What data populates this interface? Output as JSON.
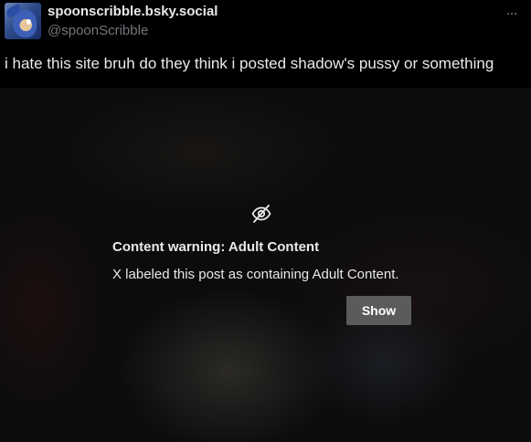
{
  "post": {
    "display_name": "spoonscribble.bsky.social",
    "handle": "@spoonScribble",
    "text": "i hate this site bruh do they think i posted shadow's pussy or something",
    "more_icon": "more-dots-icon",
    "avatar_icon": "avatar"
  },
  "media": {
    "warning_icon": "eye-slash-icon",
    "warning_title": "Content warning: Adult Content",
    "warning_body": "X labeled this post as containing Adult Content.",
    "show_label": "Show"
  },
  "colors": {
    "background": "#000000",
    "text_primary": "#e7e9ea",
    "text_secondary": "#71767b",
    "button_bg": "#5b5b5b"
  }
}
